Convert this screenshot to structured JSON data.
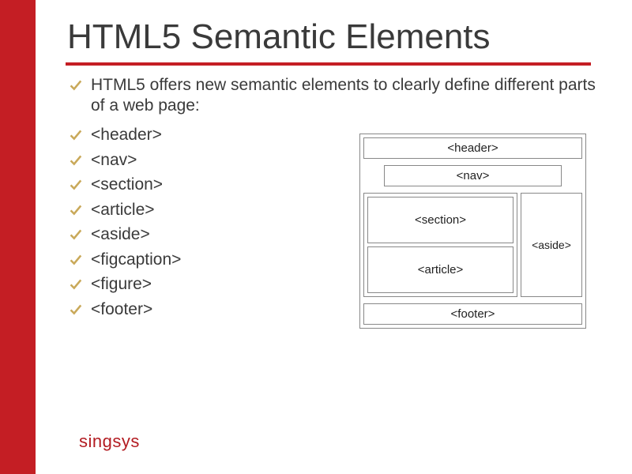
{
  "title": "HTML5 Semantic Elements",
  "subtitle": "HTML5 offers new semantic elements to clearly define different parts of a web page:",
  "list": [
    "<header>",
    "<nav>",
    "<section>",
    "<article>",
    "<aside>",
    "<figcaption>",
    "<figure>",
    "<footer>"
  ],
  "diagram": {
    "header": "<header>",
    "nav": "<nav>",
    "section": "<section>",
    "article": "<article>",
    "aside": "<aside>",
    "footer": "<footer>"
  },
  "brand": "singsys"
}
